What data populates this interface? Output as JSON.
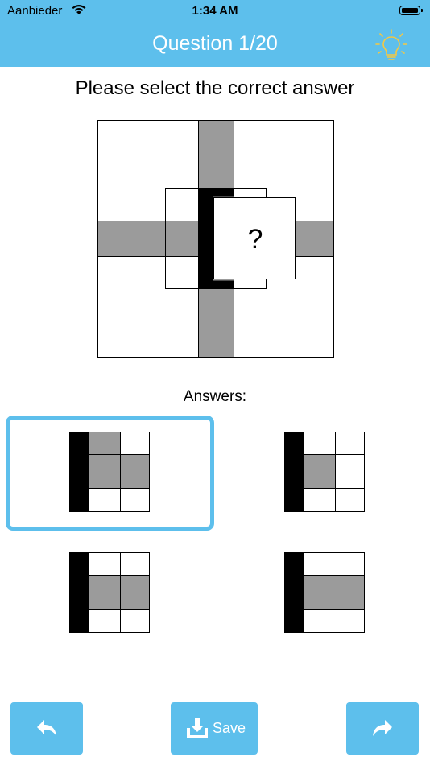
{
  "status_bar": {
    "carrier": "Aanbieder",
    "time": "1:34 AM"
  },
  "header": {
    "title": "Question 1/20",
    "hint_icon": "lightbulb-icon"
  },
  "prompt": "Please select the correct answer",
  "puzzle": {
    "missing_label": "?"
  },
  "answers": {
    "label": "Answers:",
    "selected_index": 0,
    "count": 4
  },
  "footer": {
    "save_label": "Save",
    "back_icon": "undo-arrow-icon",
    "forward_icon": "redo-arrow-icon",
    "save_icon": "download-tray-icon"
  },
  "colors": {
    "accent": "#5dbfec",
    "gray_fill": "#9b9b9b",
    "black_fill": "#000000",
    "hint": "#f5c842"
  }
}
